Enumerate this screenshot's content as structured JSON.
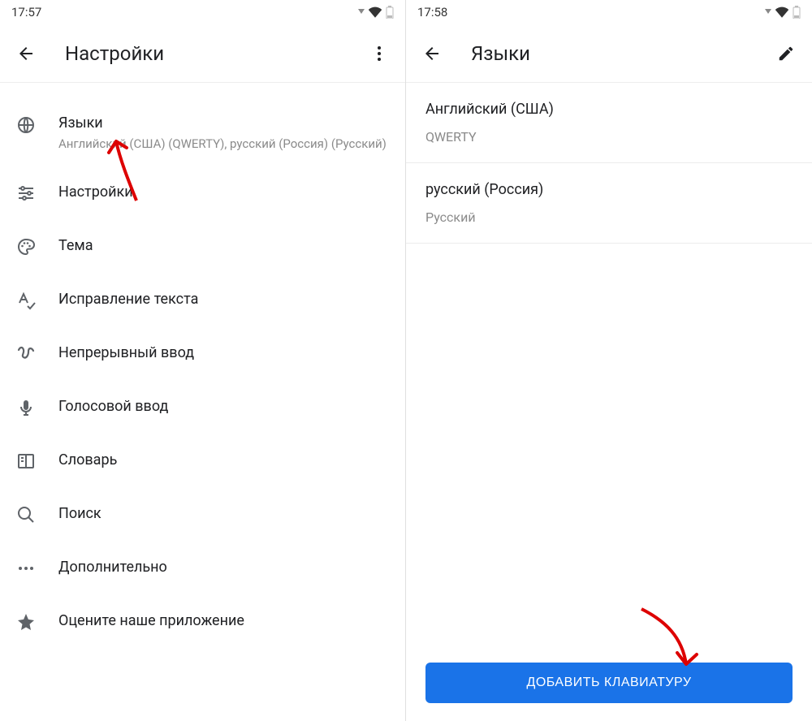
{
  "left": {
    "status_time": "17:57",
    "title": "Настройки",
    "items": [
      {
        "title": "Языки",
        "sub": "Английский (США) (QWERTY), русский (Россия) (Русский)"
      },
      {
        "title": "Настройки"
      },
      {
        "title": "Тема"
      },
      {
        "title": "Исправление текста"
      },
      {
        "title": "Непрерывный ввод"
      },
      {
        "title": "Голосовой ввод"
      },
      {
        "title": "Словарь"
      },
      {
        "title": "Поиск"
      },
      {
        "title": "Дополнительно"
      },
      {
        "title": "Оцените наше приложение"
      }
    ]
  },
  "right": {
    "status_time": "17:58",
    "title": "Языки",
    "langs": [
      {
        "name": "Английский (США)",
        "sub": "QWERTY"
      },
      {
        "name": "русский (Россия)",
        "sub": "Русский"
      }
    ],
    "add_button": "ДОБАВИТЬ КЛАВИАТУРУ"
  }
}
